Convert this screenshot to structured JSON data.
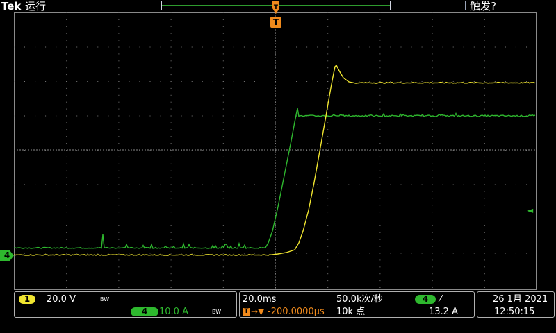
{
  "header": {
    "brand": "Tek",
    "status": "运行",
    "trigger_status": "触发?"
  },
  "trigger_marker": "T",
  "channel4_marker": "4",
  "trigger_level_arrow": "◄",
  "colors": {
    "ch1": "#f0e530",
    "ch4": "#2eb82e",
    "trigger": "#f08a1c",
    "grid": "#8a8a8a"
  },
  "channel_panel": {
    "ch1": {
      "badge": "1",
      "scale": "20.0 V",
      "bandwidth": "BW"
    },
    "ch4": {
      "badge": "4",
      "scale": "10.0 A",
      "bandwidth": "BW"
    }
  },
  "timebase_panel": {
    "time_per_div": "20.0ms",
    "sample_rate": "50.0k次/秒",
    "position_prefix": "→▼",
    "position": "-200.0000μs",
    "record_length": "10k 点",
    "trigger_source_badge": "4",
    "trigger_slope": "⁄",
    "trigger_level": "13.2 A"
  },
  "datetime_panel": {
    "date": "26 1月 2021",
    "time": "12:50:15"
  }
}
